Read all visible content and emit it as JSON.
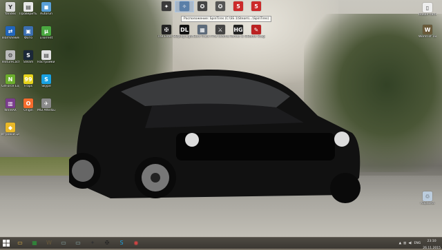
{
  "desktop": {
    "icons_left": [
      {
        "label": "Yandex",
        "icon": "yandex-icon",
        "color": "#d9d9d9",
        "glyph": "Y"
      },
      {
        "label": "Проверить орфографию",
        "icon": "document-icon",
        "color": "#e8e8e8",
        "glyph": "▤"
      },
      {
        "label": "Autorun",
        "icon": "exe-icon",
        "color": "#5aa0d8",
        "glyph": "◼"
      },
      {
        "label": "TeamViewer",
        "icon": "teamviewer-icon",
        "color": "#2266bb",
        "glyph": "⇄"
      },
      {
        "label": "Фото",
        "icon": "photo-icon",
        "color": "#3c6fb0",
        "glyph": "▣"
      },
      {
        "label": "uTorrent",
        "icon": "utorrent-icon",
        "color": "#4aa840",
        "glyph": "µ"
      },
      {
        "label": "TextureCache",
        "icon": "gear-icon",
        "color": "#bbbbbb",
        "glyph": "⚙"
      },
      {
        "label": "Steam",
        "icon": "steam-icon",
        "color": "#1b2838",
        "glyph": "S"
      },
      {
        "label": "Настройки параметры",
        "icon": "settings-icon",
        "color": "#e0e0e0",
        "glyph": "▤"
      },
      {
        "label": "GeForce Experience",
        "icon": "nvidia-icon",
        "color": "#6cae2d",
        "glyph": "N"
      },
      {
        "label": "Fraps",
        "icon": "fraps-icon",
        "color": "#e6d21c",
        "glyph": "99"
      },
      {
        "label": "Skype",
        "icon": "skype-icon",
        "color": "#1aa1e1",
        "glyph": "S"
      },
      {
        "label": "WinRAR",
        "icon": "winrar-icon",
        "color": "#7a3c8c",
        "glyph": "▥"
      },
      {
        "label": "Origin",
        "icon": "origin-icon",
        "color": "#f56c2d",
        "glyph": "O"
      },
      {
        "label": "MSI Afterburner",
        "icon": "afterburner-icon",
        "color": "#8a8a8a",
        "glyph": "✈"
      },
      {
        "label": "Игровой центр",
        "icon": "gamecenter-icon",
        "color": "#e9b828",
        "glyph": "◆"
      }
    ],
    "icons_top": [
      {
        "label": "",
        "icon": "game-icon",
        "color": "#3a3a3a",
        "glyph": "✦"
      },
      {
        "label": "",
        "icon": "game-icon",
        "color": "#5a7fa8",
        "glyph": "✧",
        "selected": true
      },
      {
        "label": "",
        "icon": "game-icon",
        "color": "#444",
        "glyph": "✪"
      },
      {
        "label": "",
        "icon": "game-icon",
        "color": "#555",
        "glyph": "✪"
      },
      {
        "label": "",
        "icon": "game-icon",
        "color": "#cc2a2a",
        "glyph": "5"
      },
      {
        "label": "",
        "icon": "game-icon",
        "color": "#cc2a2a",
        "glyph": "5"
      }
    ],
    "icons_row2": [
      {
        "label": "The Elder Scrolls V",
        "icon": "skyrim-icon",
        "color": "#222",
        "glyph": "✠"
      },
      {
        "label": "Dying Light",
        "icon": "dyinglight-icon",
        "color": "#111",
        "glyph": "DL"
      },
      {
        "label": "Euro Truck Simulator 2",
        "icon": "ets-icon",
        "color": "#5d6b7a",
        "glyph": "▦"
      },
      {
        "label": "The Witcher Enhanced",
        "icon": "witcher-icon",
        "color": "#444",
        "glyph": "⚔"
      },
      {
        "label": "Heroes & Generals",
        "icon": "hg-icon",
        "color": "#222",
        "glyph": "HG"
      },
      {
        "label": "Battle Stage",
        "icon": "battle-icon",
        "color": "#b22",
        "glyph": "✎"
      }
    ],
    "tooltip": "Расположение: SpinTires (C:\\SS 1\\Steam\\...\\SpinTires)",
    "icons_right": [
      {
        "label": "Новая папка",
        "icon": "file-icon",
        "color": "#eee",
        "glyph": "▯"
      },
      {
        "label": "World of Tanks",
        "icon": "wot-icon",
        "color": "#6a5a3a",
        "glyph": "W"
      },
      {
        "label": "Корзина",
        "icon": "recycle-bin-icon",
        "color": "#bcd",
        "glyph": "♲"
      }
    ]
  },
  "taskbar": {
    "pinned": [
      {
        "name": "explorer-icon",
        "glyph": "▭",
        "color": "#e3b548"
      },
      {
        "name": "store-icon",
        "glyph": "▦",
        "color": "#2a9a3a"
      },
      {
        "name": "wot-icon",
        "glyph": "W",
        "color": "#6a5a3a"
      },
      {
        "name": "monitor-icon",
        "glyph": "▭",
        "color": "#8aa"
      },
      {
        "name": "monitor-icon",
        "glyph": "▭",
        "color": "#8aa"
      },
      {
        "name": "game-icon",
        "glyph": "✦",
        "color": "#333"
      },
      {
        "name": "skyrim-icon",
        "glyph": "✠",
        "color": "#222"
      },
      {
        "name": "skype-icon",
        "glyph": "S",
        "color": "#1aa1e1"
      },
      {
        "name": "chrome-icon",
        "glyph": "◉",
        "color": "#d44"
      }
    ],
    "tray_language": "ENG",
    "clock_time": "23:10",
    "clock_date": "26.11.2015"
  }
}
